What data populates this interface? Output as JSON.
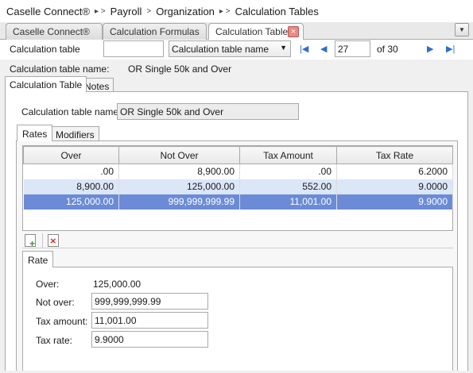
{
  "breadcrumb": {
    "items": [
      "Caselle Connect®",
      "Payroll",
      "Organization",
      "Calculation Tables"
    ],
    "sep_menu": "▸ >",
    "sep": ">"
  },
  "tabs": [
    {
      "label": "Caselle Connect®"
    },
    {
      "label": "Calculation Formulas"
    },
    {
      "label": "Calculation Tables"
    }
  ],
  "nav": {
    "field_label": "Calculation table",
    "lookup_value": "",
    "select_value": "Calculation table name",
    "record_number": "27",
    "record_total": "of 30"
  },
  "header": {
    "name_label": "Calculation table name:",
    "name_value": "OR Single 50k and Over"
  },
  "subtabs": [
    "Calculation Table",
    "Notes"
  ],
  "form": {
    "name_label": "Calculation table name:",
    "name_value": "OR Single 50k and Over"
  },
  "inner_tabs": [
    "Rates",
    "Modifiers"
  ],
  "grid": {
    "columns": [
      "Over",
      "Not Over",
      "Tax Amount",
      "Tax Rate"
    ],
    "rows": [
      [
        ".00",
        "8,900.00",
        ".00",
        "6.2000"
      ],
      [
        "8,900.00",
        "125,000.00",
        "552.00",
        "9.0000"
      ],
      [
        "125,000.00",
        "999,999,999.99",
        "11,001.00",
        "9.9000"
      ]
    ]
  },
  "detail": {
    "tab": "Rate",
    "over_label": "Over:",
    "over_value": "125,000.00",
    "not_over_label": "Not over:",
    "not_over_value": "999,999,999.99",
    "tax_amount_label": "Tax amount:",
    "tax_amount_value": "11,001.00",
    "tax_rate_label": "Tax rate:",
    "tax_rate_value": "9.9000"
  },
  "icons": {
    "close": "close-icon",
    "first": "first-record-icon",
    "prev": "previous-record-icon",
    "next": "next-record-icon",
    "last": "last-record-icon",
    "add": "add-row-icon",
    "delete": "delete-row-icon"
  },
  "colors": {
    "selected_row": "#6b8bd6",
    "alt_row": "#dbe7f7",
    "nav_blue": "#2e6fc8"
  }
}
